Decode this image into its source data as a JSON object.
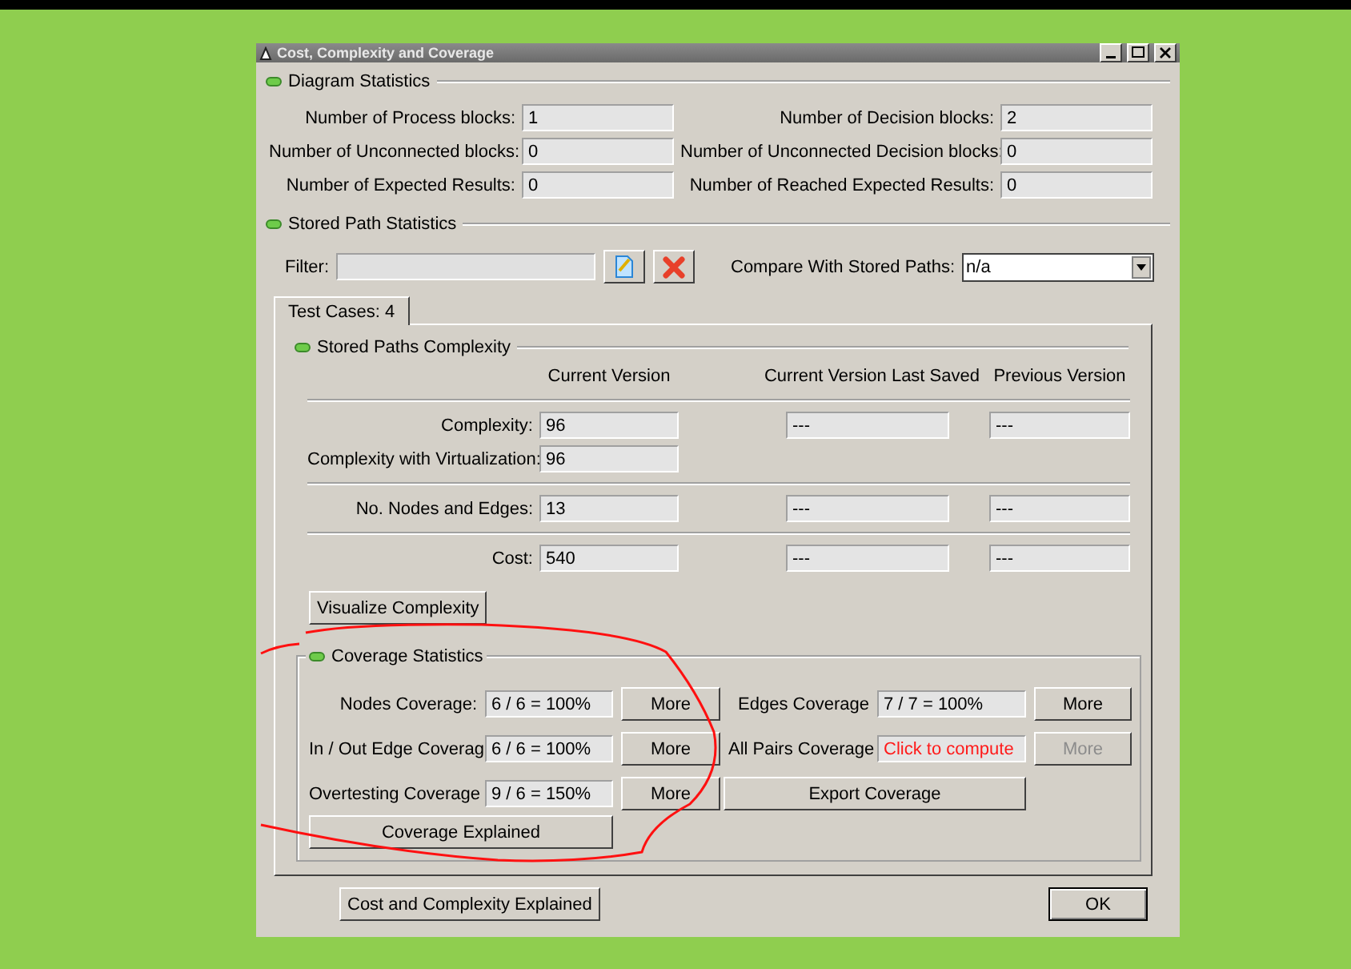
{
  "window": {
    "title": "Cost, Complexity and Coverage"
  },
  "diagram_statistics": {
    "title": "Diagram Statistics",
    "fields": [
      {
        "label": "Number of Process blocks:",
        "value": "1"
      },
      {
        "label": "Number of Decision blocks:",
        "value": "2"
      },
      {
        "label": "Number of Unconnected blocks:",
        "value": "0"
      },
      {
        "label": "Number of Unconnected Decision blocks:",
        "value": "0"
      },
      {
        "label": "Number of Expected Results:",
        "value": "0"
      },
      {
        "label": "Number of Reached Expected Results:",
        "value": "0"
      }
    ]
  },
  "stored_path_statistics": {
    "title": "Stored Path Statistics",
    "filter": {
      "label": "Filter:"
    },
    "compare": {
      "label": "Compare With Stored Paths:",
      "value": "n/a"
    }
  },
  "tabs": [
    {
      "label": "Test Cases: 4",
      "selected": true
    }
  ],
  "stored_paths_complexity": {
    "title": "Stored Paths Complexity",
    "columns": [
      "Current Version",
      "Current Version Last Saved",
      "Previous Version"
    ],
    "groups": [
      [
        {
          "label": "Complexity:",
          "values": [
            "96",
            "---",
            "---"
          ]
        },
        {
          "label": "Complexity with Virtualization:",
          "values": [
            "96"
          ]
        }
      ],
      [
        {
          "label": "No. Nodes and Edges:",
          "values": [
            "13",
            "---",
            "---"
          ]
        }
      ],
      [
        {
          "label": "Cost:",
          "values": [
            "540",
            "---",
            "---"
          ]
        }
      ]
    ],
    "visualize_button": "Visualize Complexity"
  },
  "coverage_statistics": {
    "title": "Coverage Statistics",
    "left": [
      {
        "label": "Nodes Coverage:",
        "value": "6 / 6 = 100%",
        "kind": "value",
        "button": {
          "label": "More",
          "disabled": false
        }
      },
      {
        "label": "In / Out Edge Coverag",
        "value": "6 / 6 = 100%",
        "kind": "value",
        "button": {
          "label": "More",
          "disabled": false
        }
      },
      {
        "label": "Overtesting Coverage",
        "value": "9 / 6 = 150%",
        "kind": "value",
        "button": {
          "label": "More",
          "disabled": false
        }
      }
    ],
    "right": [
      {
        "label": "Edges Coverage",
        "value": "7 / 7 = 100%",
        "kind": "value",
        "button": {
          "label": "More",
          "disabled": false
        }
      },
      {
        "label": "All Pairs Coverage",
        "value": "Click to compute",
        "kind": "action",
        "button": {
          "label": "More",
          "disabled": true
        }
      }
    ],
    "export_button": "Export Coverage",
    "explained_button": "Coverage Explained"
  },
  "footer": {
    "explained_button": "Cost and Complexity Explained",
    "ok_button": "OK"
  }
}
